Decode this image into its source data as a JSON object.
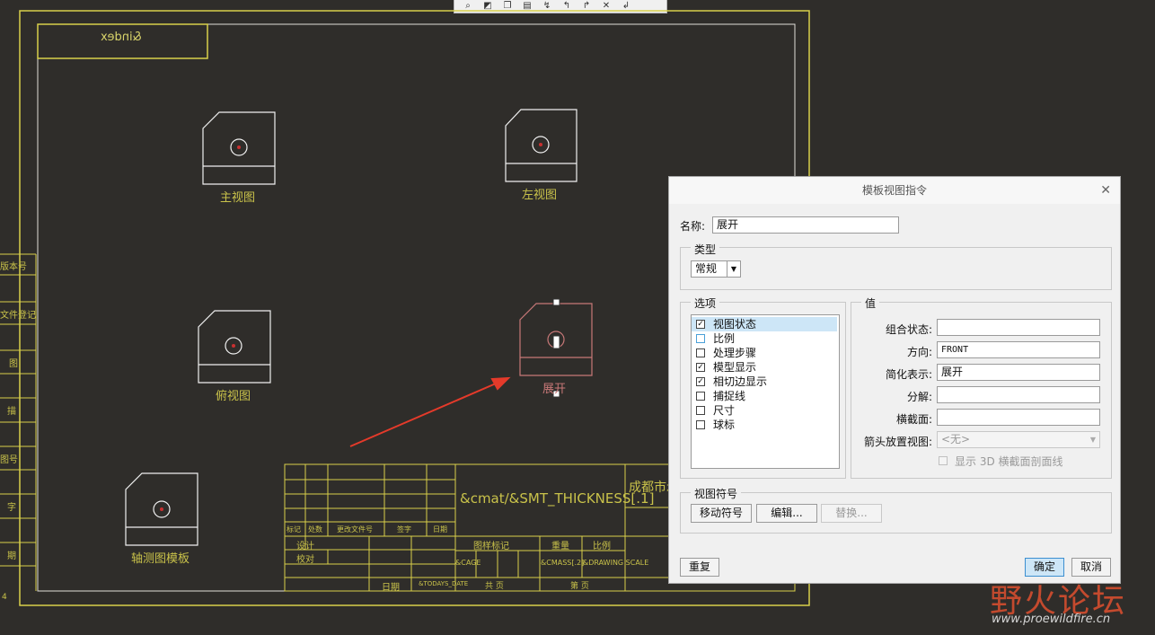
{
  "toolbar": {
    "icons": [
      "zoom-icon",
      "pan-icon",
      "view-icon",
      "layer-icon",
      "dim-icon",
      "dim2-icon",
      "dim3-icon",
      "close-x-icon",
      "dim4-icon"
    ]
  },
  "drawing": {
    "index_label": "&index",
    "views": {
      "main": "主视图",
      "left": "左视图",
      "top": "俯视图",
      "flat": "展开",
      "iso": "轴测图模板"
    },
    "left_labels": [
      "版本号",
      "文件登记",
      "图",
      "描",
      "图号",
      "字",
      "期"
    ],
    "corner_text": "4",
    "title_block": {
      "material": "&cmat/&SMT_THICKNESS[.1]",
      "company": "成都市示",
      "row_hdr": [
        "标记",
        "处数",
        "更改文件号",
        "签字",
        "日期"
      ],
      "design": "设计",
      "check": "校对",
      "approve": "日期",
      "stage_hdr": "图样标记",
      "weight_hdr": "重量",
      "scale_hdr": "比例",
      "cage": "&CAGE",
      "mass": "&CMASS[.2]",
      "scale": "&DRAWING SCALE",
      "sheet": "共  页",
      "page": "第  页",
      "fmt": "&TODAYS_DATE"
    }
  },
  "dialog": {
    "title": "模板视图指令",
    "name_label": "名称:",
    "name_value": "展开",
    "type_group": "类型",
    "type_value": "常规",
    "options_group": "选项",
    "options": [
      {
        "label": "视图状态",
        "checked": true,
        "selected": true
      },
      {
        "label": "比例",
        "checked": false,
        "selected": false
      },
      {
        "label": "处理步骤",
        "checked": false,
        "selected": false
      },
      {
        "label": "模型显示",
        "checked": true,
        "selected": false
      },
      {
        "label": "相切边显示",
        "checked": true,
        "selected": false
      },
      {
        "label": "捕捉线",
        "checked": false,
        "selected": false
      },
      {
        "label": "尺寸",
        "checked": false,
        "selected": false
      },
      {
        "label": "球标",
        "checked": false,
        "selected": false
      }
    ],
    "value_group": "值",
    "combo_state_label": "组合状态:",
    "combo_state_value": "",
    "orientation_label": "方向:",
    "orientation_value": "FRONT",
    "simplified_label": "简化表示:",
    "simplified_value": "展开",
    "explode_label": "分解:",
    "explode_value": "",
    "xsec_label": "横截面:",
    "xsec_value": "",
    "arrow_label": "箭头放置视图:",
    "arrow_value": "<无>",
    "show3d_label": "显示 3D 横截面剖面线",
    "symbol_group": "视图符号",
    "move_symbol": "移动符号",
    "edit_btn": "编辑...",
    "replace_btn": "替换...",
    "reset_btn": "重复",
    "ok_btn": "确定",
    "cancel_btn": "取消"
  },
  "watermark": {
    "brand": "野火论坛",
    "url": "www.proewildfire.cn"
  },
  "colors": {
    "background": "#2f2d2a",
    "frame": "#d8d04a",
    "view_white": "#f0f0f0",
    "highlight": "#c87878",
    "arrow": "#e53a2a",
    "ok_blue": "#cde6f7"
  }
}
